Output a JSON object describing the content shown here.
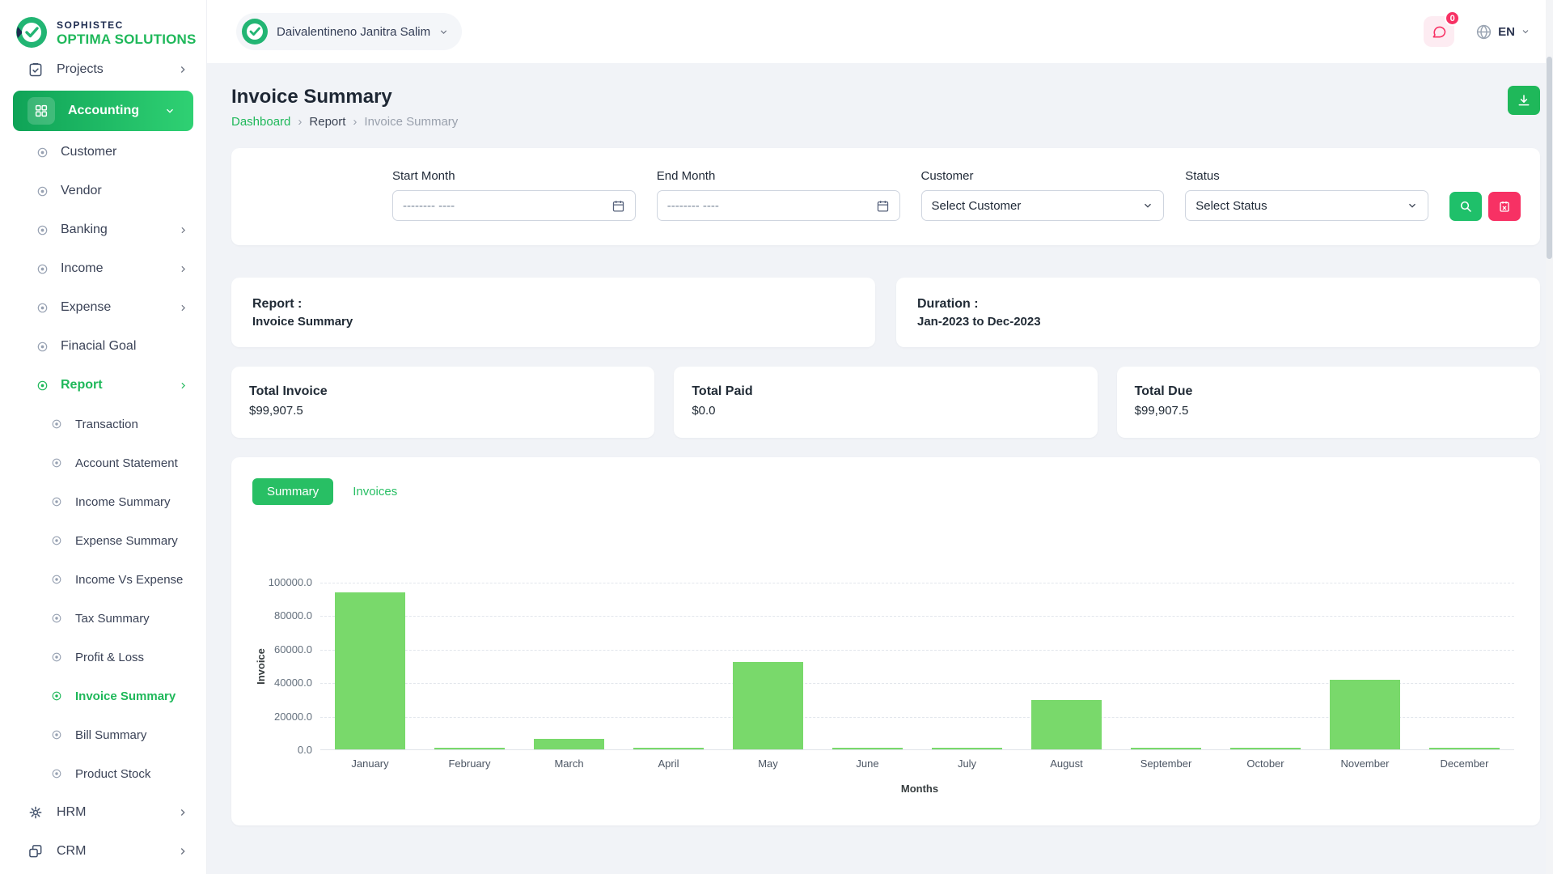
{
  "brand": {
    "line1": "SOPHISTEC",
    "line2": "OPTIMA SOLUTIONS"
  },
  "header": {
    "user_name": "Daivalentineno Janitra Salim",
    "badge_count": "0",
    "language": "EN"
  },
  "sidebar": {
    "projects": {
      "label": "Projects"
    },
    "accounting": {
      "label": "Accounting"
    },
    "accounting_children": [
      {
        "label": "Customer"
      },
      {
        "label": "Vendor"
      },
      {
        "label": "Banking"
      },
      {
        "label": "Income"
      },
      {
        "label": "Expense"
      },
      {
        "label": "Finacial Goal"
      },
      {
        "label": "Report"
      }
    ],
    "report_children": [
      {
        "label": "Transaction"
      },
      {
        "label": "Account Statement"
      },
      {
        "label": "Income Summary"
      },
      {
        "label": "Expense Summary"
      },
      {
        "label": "Income Vs Expense"
      },
      {
        "label": "Tax Summary"
      },
      {
        "label": "Profit & Loss"
      },
      {
        "label": "Invoice Summary"
      },
      {
        "label": "Bill Summary"
      },
      {
        "label": "Product Stock"
      }
    ],
    "hrm": {
      "label": "HRM"
    },
    "crm": {
      "label": "CRM"
    }
  },
  "page": {
    "title": "Invoice Summary",
    "breadcrumb": [
      {
        "label": "Dashboard"
      },
      {
        "label": "Report"
      },
      {
        "label": "Invoice Summary"
      }
    ]
  },
  "filters": {
    "start_month_label": "Start Month",
    "end_month_label": "End Month",
    "date_placeholder": "-------- ----",
    "customer_label": "Customer",
    "customer_value": "Select Customer",
    "status_label": "Status",
    "status_value": "Select Status"
  },
  "info_cards": {
    "report_label": "Report :",
    "report_value": "Invoice Summary",
    "duration_label": "Duration :",
    "duration_value": "Jan-2023 to Dec-2023"
  },
  "stats": [
    {
      "label": "Total Invoice",
      "value": "$99,907.5"
    },
    {
      "label": "Total Paid",
      "value": "$0.0"
    },
    {
      "label": "Total Due",
      "value": "$99,907.5"
    }
  ],
  "tabs": {
    "summary": "Summary",
    "invoices": "Invoices"
  },
  "chart_data": {
    "type": "bar",
    "title": "",
    "xlabel": "Months",
    "ylabel": "Invoice",
    "categories": [
      "January",
      "February",
      "March",
      "April",
      "May",
      "June",
      "July",
      "August",
      "September",
      "October",
      "November",
      "December"
    ],
    "values": [
      93500,
      1100,
      6300,
      1000,
      52000,
      1000,
      900,
      29500,
      700,
      500,
      41400,
      800
    ],
    "ylim": [
      0,
      100000
    ],
    "yticks": [
      "0.0",
      "20000.0",
      "40000.0",
      "60000.0",
      "80000.0",
      "100000.0"
    ],
    "bar_color": "#79d96b",
    "grid": "dashed-horizontal",
    "legend": "none"
  },
  "colors": {
    "primary_green": "#1fb85a",
    "gradient_start": "#0fa357",
    "gradient_end": "#2fd173",
    "pink": "#f73164",
    "bar": "#79d96b",
    "background": "#f1f3f7"
  }
}
